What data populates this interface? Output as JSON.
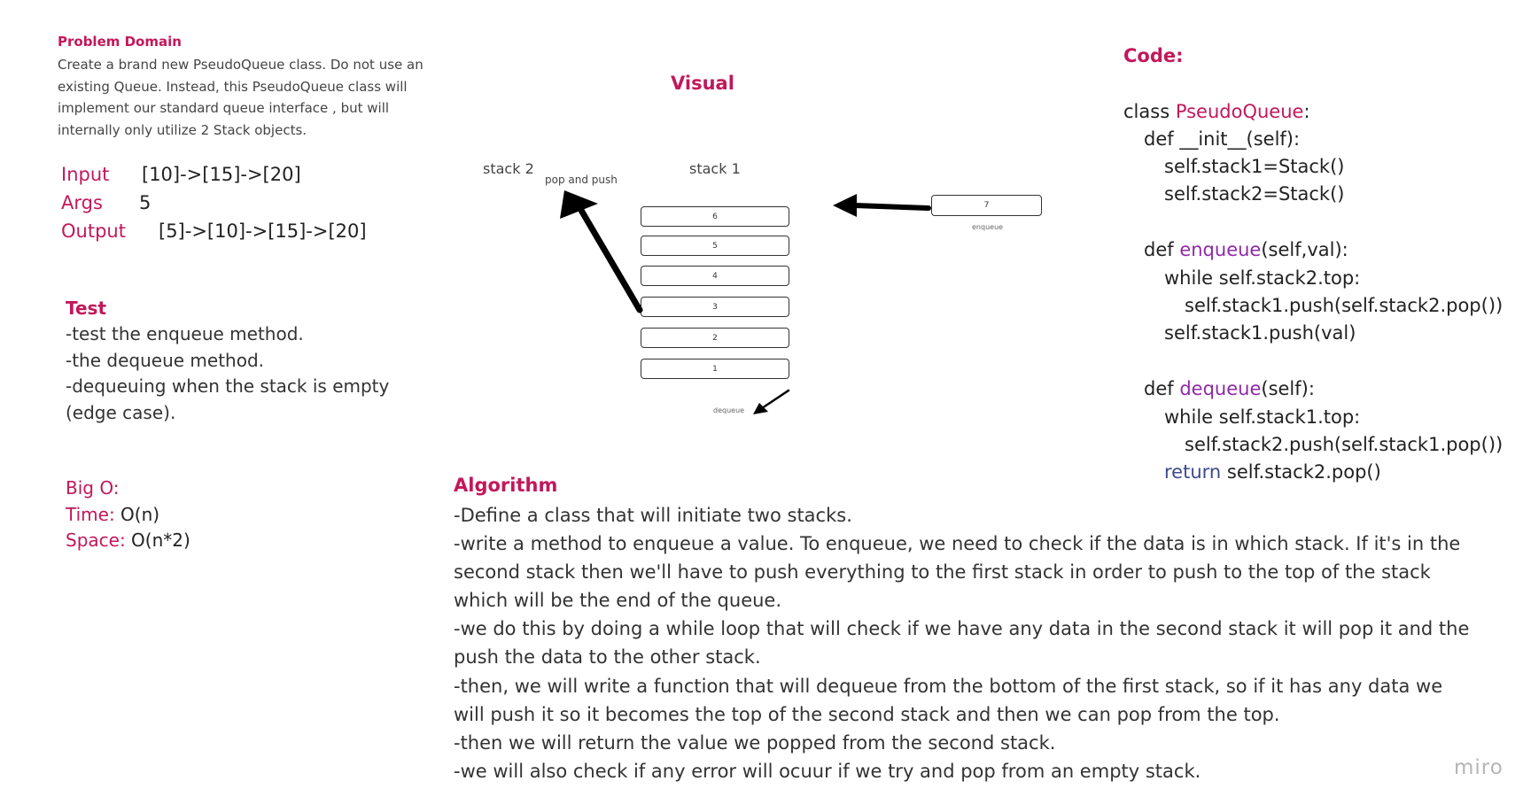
{
  "problem_domain": {
    "heading": "Problem Domain",
    "text": "Create a brand new PseudoQueue class. Do not use an existing Queue. Instead, this PseudoQueue class will implement our standard queue interface , but will internally only utilize 2 Stack objects."
  },
  "io": {
    "input_label": "Input",
    "input_value": "[10]->[15]->[20]",
    "args_label": "Args",
    "args_value": "5",
    "output_label": "Output",
    "output_value": "[5]->[10]->[15]->[20]"
  },
  "test": {
    "heading": "Test",
    "lines": [
      "-test the enqueue method.",
      "-the dequeue method.",
      "-dequeuing when the stack is empty",
      "(edge case)."
    ]
  },
  "big_o": {
    "heading": "Big O:",
    "time_label": "Time:",
    "time_value": "O(n)",
    "space_label": "Space:",
    "space_value": "O(n*2)"
  },
  "visual": {
    "title": "Visual",
    "stack2_label": "stack 2",
    "stack1_label": "stack 1",
    "pop_push_label": "pop and push",
    "stack_items": [
      "6",
      "5",
      "4",
      "3",
      "2",
      "1"
    ],
    "enqueue_item": "7",
    "enqueue_label": "enqueue",
    "dequeue_label": "dequeue"
  },
  "code": {
    "heading": "Code:",
    "class_kw": "class ",
    "class_name": "PseudoQueue",
    "class_colon": ":",
    "init_line": "def __init__(self):",
    "stack1_line": "self.stack1=Stack()",
    "stack2_line": "self.stack2=Stack()",
    "def_kw": "def ",
    "enqueue_name": "enqueue",
    "enqueue_args": "(self,val):",
    "while_stack2": "while self.stack2.top:",
    "push_stack1": "self.stack1.push(self.stack2.pop())",
    "push_val": "self.stack1.push(val)",
    "dequeue_name": "dequeue",
    "dequeue_args": "(self):",
    "while_stack1": "while self.stack1.top:",
    "push_stack2": "self.stack2.push(self.stack1.pop())",
    "return_kw": "return",
    "return_rest": " self.stack2.pop()"
  },
  "algorithm": {
    "heading": "Algorithm",
    "lines": [
      "-Define a class that will initiate two stacks.",
      "-write a method to enqueue a value. To enqueue, we need to check if the data is in which stack. If it's in the second stack then we'll have to push everything to the first stack in order to push to the top of the stack which will be the end of the queue.",
      "-we do this by doing a while loop that will check if we have any data in the second stack it will pop it and the push the data to the other stack.",
      "-then, we will write a function that will dequeue from the bottom of the first stack, so if it has any data we will push it so it becomes the top of the second stack and then we can pop from the top.",
      "-then we will return the value we popped from the second stack.",
      "-we will also check if any error will ocuur if we try and pop from an empty stack."
    ]
  },
  "brand": "miro",
  "colors": {
    "accent": "#c2185b",
    "code_name": "#8e2aa6",
    "keyword": "#3d4a8c"
  }
}
